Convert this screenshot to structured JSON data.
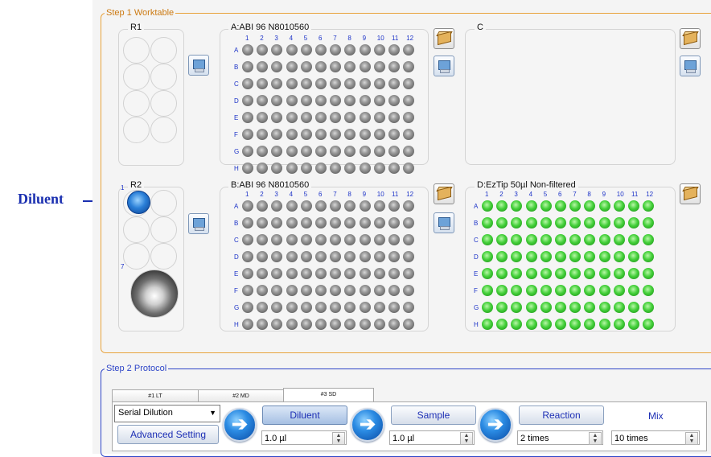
{
  "annotation": {
    "label": "Diluent",
    "arrow": "⟶"
  },
  "step1": {
    "legend": "Step 1 Worktable",
    "r1": {
      "title": "R1"
    },
    "r2": {
      "title": "R2",
      "marker1": "1",
      "marker7": "7"
    },
    "plate_a": {
      "title": "A:ABI 96 N8010560"
    },
    "plate_b": {
      "title": "B:ABI 96 N8010560"
    },
    "plate_c": {
      "title": "C"
    },
    "plate_d": {
      "title": "D:EzTip 50µl Non-filtered"
    },
    "col_labels": [
      "1",
      "2",
      "3",
      "4",
      "5",
      "6",
      "7",
      "8",
      "9",
      "10",
      "11",
      "12"
    ],
    "row_labels": [
      "A",
      "B",
      "C",
      "D",
      "E",
      "F",
      "G",
      "H"
    ],
    "colors": {
      "frame": "#e8a33c",
      "well_gray": "#5a5a5a",
      "well_green": "#2dbb24",
      "label_blue": "#1d33c8"
    }
  },
  "step2": {
    "legend": "Step 2 Protocol",
    "tabs": [
      "#1 LT",
      "#2 MD",
      "#3 SD"
    ],
    "active_tab": "#3 SD",
    "mode_select": {
      "value": "Serial Dilution",
      "arrow": "▼"
    },
    "advanced_button": "Advanced Setting",
    "diluent_button": "Diluent",
    "sample_button": "Sample",
    "reaction_button": "Reaction",
    "mix_label": "Mix",
    "diluent_volume": "1.0 µl",
    "sample_volume": "1.0 µl",
    "reaction_times": "2 times",
    "mix_times": "10 times",
    "arrow_glyph": "➔",
    "spin_up": "▲",
    "spin_down": "▼"
  }
}
